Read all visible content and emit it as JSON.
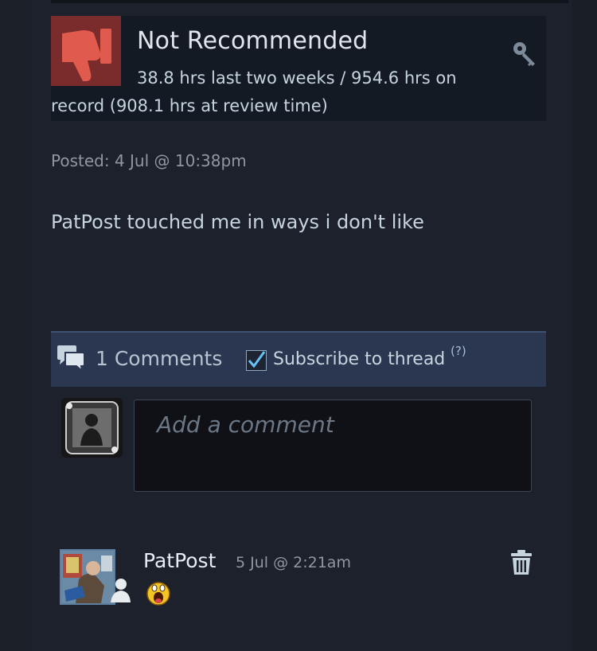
{
  "review": {
    "verdict": "Not Recommended",
    "hours_line1": "38.8 hrs last two weeks / 954.6 hrs on",
    "hours_line2": "record (908.1 hrs at review time)",
    "posted": "Posted: 4 Jul @ 10:38pm",
    "body": "PatPost touched me in ways i don't like",
    "verdict_icon": "thumbs-down-icon",
    "product_key_icon": "key-icon",
    "verdict_color": "#7a2b2b"
  },
  "comments_bar": {
    "count_label": "1 Comments",
    "subscribe_label": "Subscribe to thread",
    "subscribe_checked": true,
    "help_label": "(?)",
    "accent": "#2b3750"
  },
  "comment_form": {
    "placeholder": "Add a comment"
  },
  "comments": [
    {
      "author": "PatPost",
      "date": "5 Jul @ 2:21am",
      "content_icon": "laughing-emoticon-icon",
      "delete_icon": "trash-icon"
    }
  ]
}
